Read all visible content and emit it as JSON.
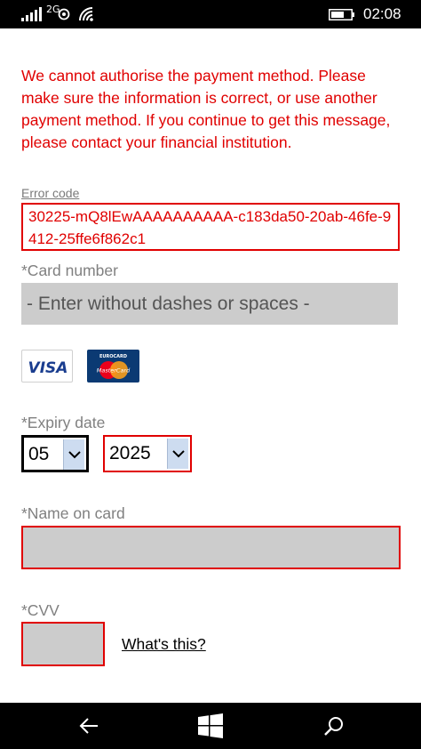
{
  "status_bar": {
    "network_type": "2G",
    "time": "02:08"
  },
  "error": {
    "message": "We cannot authorise the payment method. Please make sure the information is correct, or use another payment method. If you continue to get this message, please contact your financial institution.",
    "code_label": "Error code",
    "code_value": "30225-mQ8lEwAAAAAAAAAA-c183da50-20ab-46fe-9412-25ffe6f862c1",
    "color": "#e00000"
  },
  "card_number": {
    "label": "*Card number",
    "value": "",
    "placeholder": "- Enter without dashes or spaces -"
  },
  "card_brands": [
    {
      "name": "VISA",
      "icon": "visa-logo"
    },
    {
      "name": "EUROCARD MasterCard",
      "icon": "mastercard-logo",
      "brand_top": "EUROCARD",
      "brand_text": "MasterCard"
    }
  ],
  "expiry": {
    "label": "*Expiry date",
    "month": "05",
    "year": "2025"
  },
  "name_on_card": {
    "label": "*Name on card",
    "value": ""
  },
  "cvv": {
    "label": "*CVV",
    "value": "",
    "help_link": "What's this?"
  },
  "nav_bar": {
    "back_icon": "back-arrow-icon",
    "home_icon": "windows-logo-icon",
    "search_icon": "search-icon"
  }
}
